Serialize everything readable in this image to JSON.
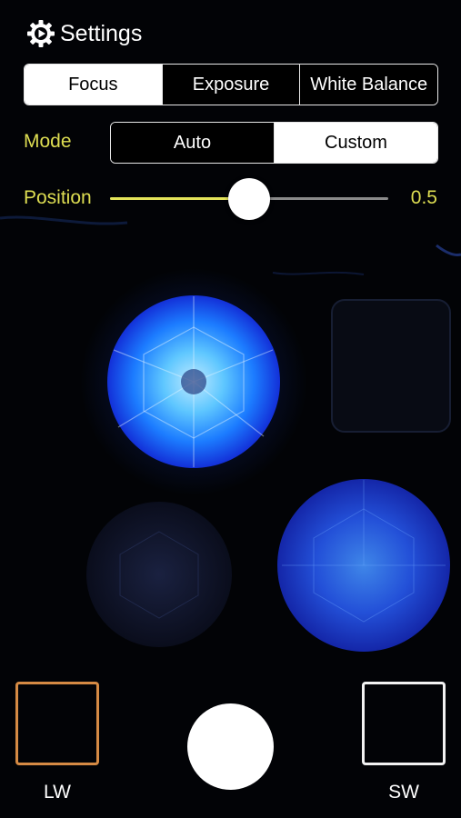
{
  "header": {
    "title": "Settings",
    "icon": "gear-icon"
  },
  "tabs": [
    {
      "label": "Focus",
      "active": true
    },
    {
      "label": "Exposure",
      "active": false
    },
    {
      "label": "White Balance",
      "active": false
    }
  ],
  "mode": {
    "label": "Mode",
    "options": [
      {
        "label": "Auto",
        "active": false
      },
      {
        "label": "Custom",
        "active": true
      }
    ]
  },
  "position": {
    "label": "Position",
    "value": 0.5,
    "value_text": "0.5"
  },
  "controls": {
    "lw_label": "LW",
    "sw_label": "SW"
  },
  "colors": {
    "accent_yellow": "#dede52",
    "lw_border": "#d58a44",
    "sw_border": "#f2f2f2",
    "background": "#020306"
  }
}
